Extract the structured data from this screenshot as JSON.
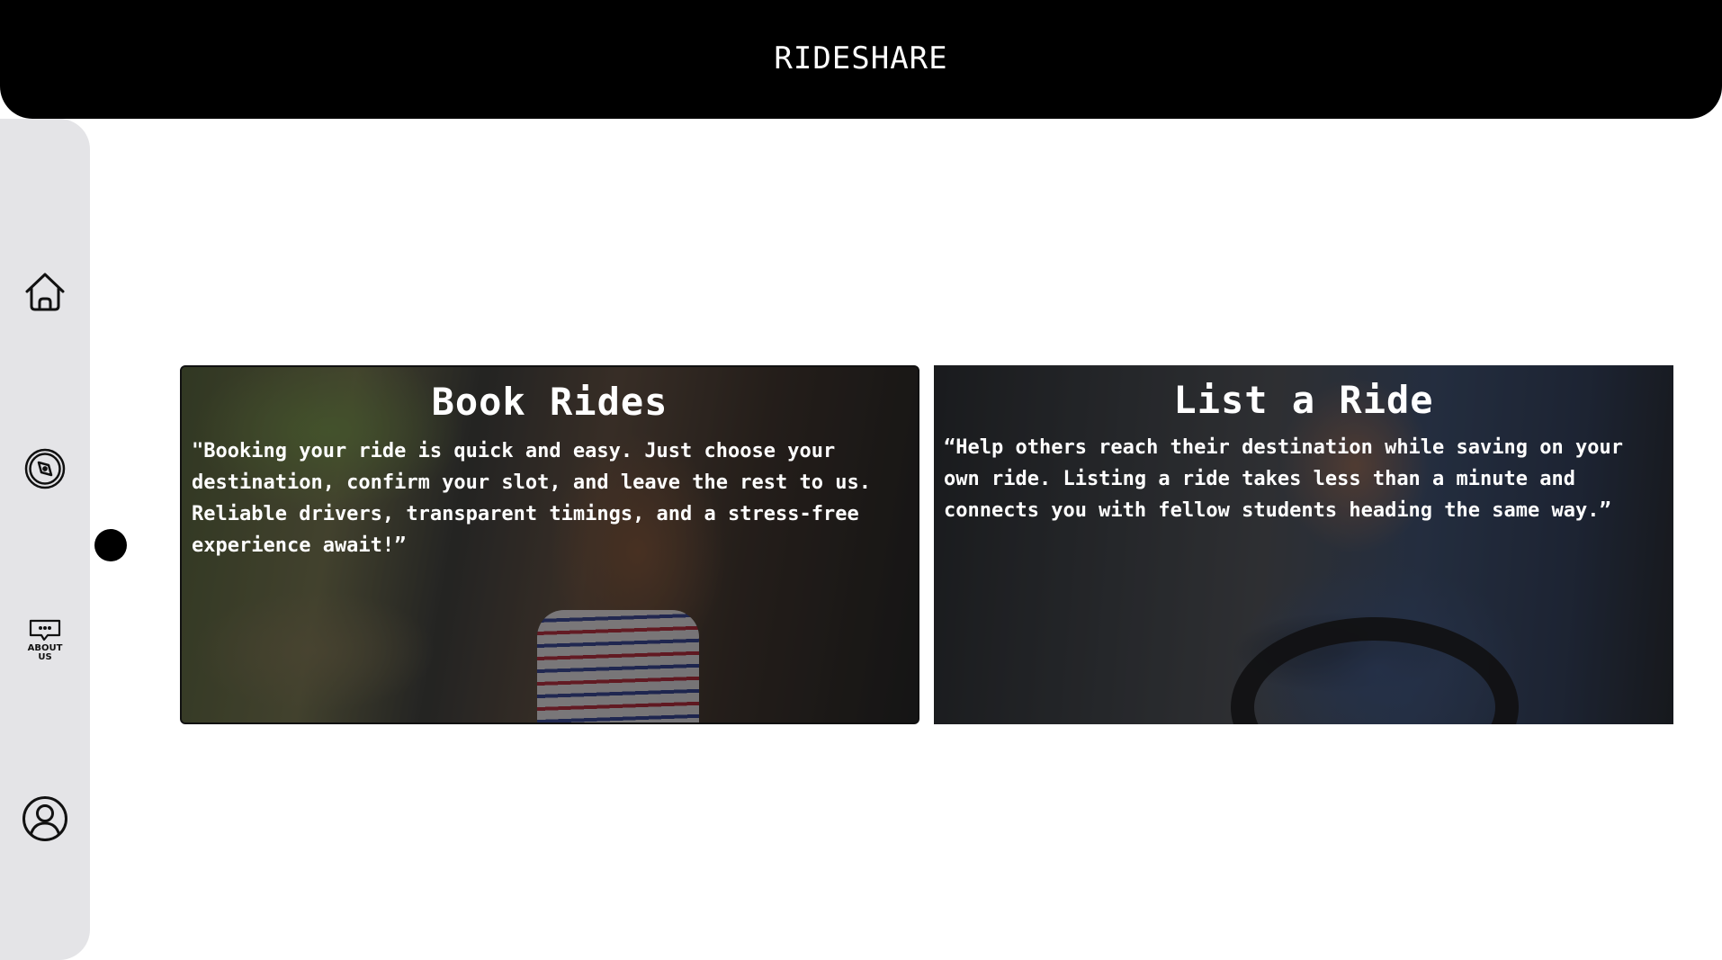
{
  "header": {
    "title": "RIDESHARE"
  },
  "sidebar": {
    "items": [
      {
        "icon": "home-icon"
      },
      {
        "icon": "compass-icon"
      },
      {
        "icon": "chat-icon",
        "label": "ABOUT US"
      },
      {
        "icon": "user-icon"
      }
    ]
  },
  "cards": [
    {
      "title": "Book Rides",
      "text": "\"Booking your ride is quick and easy. Just choose your destination, confirm your slot, and leave the rest to us. Reliable drivers, transparent timings, and a stress-free experience await!”"
    },
    {
      "title": "List a Ride",
      "text": "“Help others reach their destination while saving on your own ride. Listing a ride takes less than a minute and connects you with fellow students heading the same way.”"
    }
  ],
  "colors": {
    "header_bg": "#000000",
    "sidebar_bg": "#e4e4e7",
    "text_light": "#ffffff"
  }
}
